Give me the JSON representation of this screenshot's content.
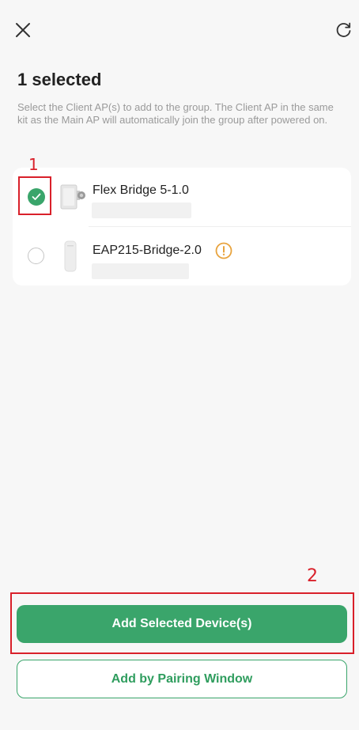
{
  "header": {
    "close_icon": "close-icon",
    "refresh_icon": "refresh-icon"
  },
  "title": "1 selected",
  "description": "Select the Client AP(s) to add to the group. The Client AP in the same kit as the Main AP will automatically join the group after powered on.",
  "devices": [
    {
      "name": "Flex Bridge 5-1.0",
      "selected": true,
      "icon": "outdoor-bridge-icon"
    },
    {
      "name": "EAP215-Bridge-2.0",
      "selected": false,
      "icon": "bridge-ap-icon",
      "warning_icon": "warning-icon"
    }
  ],
  "annotations": [
    "1",
    "2"
  ],
  "buttons": {
    "add_selected": "Add Selected Device(s)",
    "add_by_pairing": "Add by Pairing Window"
  },
  "colors": {
    "accent": "#3aa56b",
    "warning": "#e8a33d",
    "annotation": "#d9202a"
  }
}
